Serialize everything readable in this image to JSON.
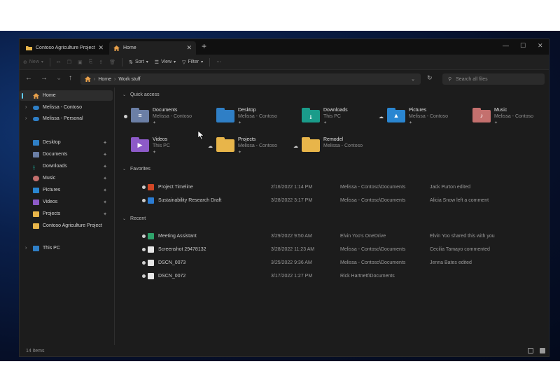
{
  "tabs": [
    {
      "label": "Contoso Agriculture Project",
      "icon": "folder-icon"
    },
    {
      "label": "Home",
      "icon": "home-icon"
    }
  ],
  "toolbar": {
    "new_label": "New",
    "sort_label": "Sort",
    "view_label": "View",
    "filter_label": "Filter",
    "more_label": "···"
  },
  "address": {
    "crumbs": [
      "Home",
      "Work stuff"
    ],
    "search_placeholder": "Search all files"
  },
  "sidebar": {
    "home": "Home",
    "clouds": [
      "Melissa - Contoso",
      "Melissa - Personal"
    ],
    "pinned": [
      "Desktop",
      "Documents",
      "Downloads",
      "Music",
      "Pictures",
      "Videos",
      "Projects",
      "Contoso Agriculture Project"
    ],
    "this_pc": "This PC"
  },
  "quick_access": {
    "title": "Quick access",
    "items": [
      {
        "name": "Documents",
        "location": "Melissa - Contoso",
        "icon": "documents-folder-icon",
        "color": "#6b7fa6"
      },
      {
        "name": "Desktop",
        "location": "Melissa - Contoso",
        "icon": "desktop-folder-icon",
        "color": "#2f7fc6"
      },
      {
        "name": "Downloads",
        "location": "This PC",
        "icon": "downloads-folder-icon",
        "color": "#1a9c8a"
      },
      {
        "name": "Pictures",
        "location": "Melissa - Contoso",
        "icon": "pictures-folder-icon",
        "color": "#2a86d1"
      },
      {
        "name": "Music",
        "location": "Melissa - Contoso",
        "icon": "music-folder-icon",
        "color": "#c4706e"
      },
      {
        "name": "Videos",
        "location": "This PC",
        "icon": "videos-folder-icon",
        "color": "#8d5ac8"
      },
      {
        "name": "Projects",
        "location": "Melissa - Contoso",
        "icon": "folder-icon",
        "color": "#e8b54a"
      },
      {
        "name": "Remodel",
        "location": "Melissa - Contoso",
        "icon": "folder-icon",
        "color": "#e8b54a"
      }
    ]
  },
  "favorites": {
    "title": "Favorites",
    "rows": [
      {
        "name": "Project Timeline",
        "date": "2/16/2022 1:14 PM",
        "location": "Melissa - Contoso\\Documents",
        "activity": "Jack Purton edited",
        "icon_color": "#d24726"
      },
      {
        "name": "Sustainability Research Draft",
        "date": "3/28/2022 3:17 PM",
        "location": "Melissa - Contoso\\Documents",
        "activity": "Alicia Snow left a comment",
        "icon_color": "#2b7cd3"
      }
    ]
  },
  "recent": {
    "title": "Recent",
    "rows": [
      {
        "name": "Meeting Assistant",
        "date": "3/29/2022 9:50 AM",
        "location": "Elvin Yoo's OneDrive",
        "activity": "Elvin Yoo shared this with you",
        "icon_color": "#2fa36b"
      },
      {
        "name": "Screenshot 29478132",
        "date": "3/28/2022 11:23 AM",
        "location": "Melissa - Contoso\\Documents",
        "activity": "Cecilia Tamayo commented",
        "icon_color": "#e6e6e6"
      },
      {
        "name": "DSCN_0073",
        "date": "3/25/2022 9:36 AM",
        "location": "Melissa - Contoso\\Documents",
        "activity": "Jenna Bates edited",
        "icon_color": "#e6e6e6"
      },
      {
        "name": "DSCN_0072",
        "date": "3/17/2022 1:27 PM",
        "location": "Rick Hartnett\\Documents",
        "activity": "",
        "icon_color": "#e6e6e6"
      }
    ]
  },
  "status": {
    "count": "14 items"
  },
  "colors": {
    "accent": "#60cdff",
    "window_bg": "#1c1c1c"
  }
}
